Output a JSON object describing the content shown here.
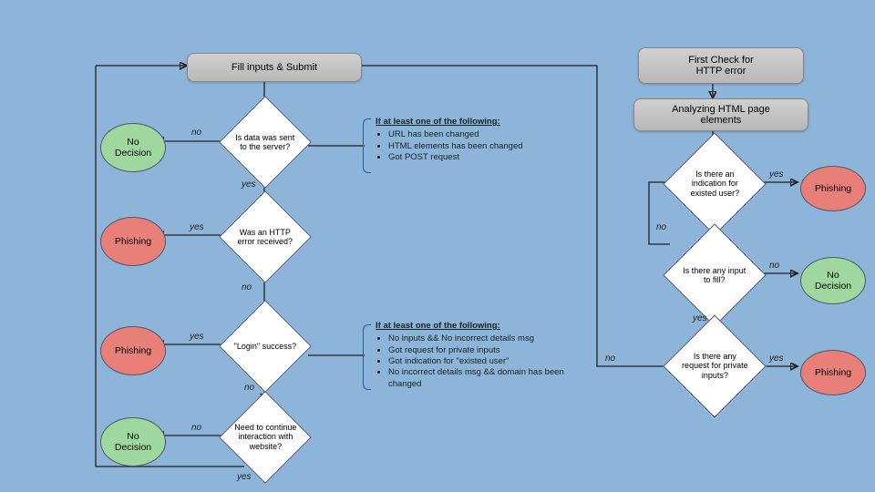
{
  "boxes": {
    "fill_inputs": "Fill inputs & Submit",
    "first_check": "First Check for\nHTTP error",
    "analyzing": "Analyzing HTML page\nelements"
  },
  "ovals": {
    "no_decision": "No\nDecision",
    "phishing": "Phishing"
  },
  "diamonds": {
    "d1": "Is data was sent to the server?",
    "d2": "Was an HTTP error received?",
    "d3": "\"Login\" success?",
    "d4": "Need to continue interaction with website?",
    "r1": "Is there an indication for existed user?",
    "r2": "Is there any input to fill?",
    "r3": "Is there any request for private inputs?"
  },
  "labels": {
    "yes": "yes",
    "no": "no"
  },
  "callouts": {
    "c1": {
      "header": "If at least one of the following:",
      "items": [
        "URL has been changed",
        "HTML elements has been changed",
        "Got POST request"
      ]
    },
    "c2": {
      "header": "If at least one of the following:",
      "items": [
        "No inputs && No incorrect details msg",
        "Got request for private inputs",
        "Got indication for \"existed user\"",
        "No incorrect details msg && domain has been changed"
      ]
    }
  }
}
